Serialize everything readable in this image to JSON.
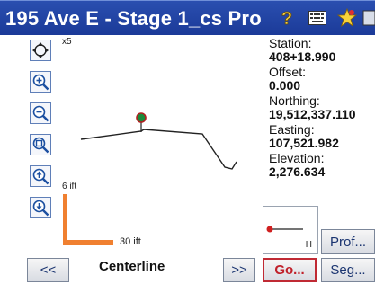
{
  "window": {
    "title": "195 Ave E - Stage 1_cs Pro"
  },
  "titlebar_icons": [
    "help-icon",
    "keyboard-icon",
    "star-icon"
  ],
  "toolbar": {
    "zoom_label": "x5",
    "tools": [
      "pan-tool-icon",
      "zoom-in-icon",
      "zoom-out-icon",
      "zoom-window-icon",
      "scroll-up-icon",
      "scroll-down-icon"
    ]
  },
  "graph": {
    "vertical_scale_label": "6 ift",
    "horizontal_scale_label": "30 ift",
    "scale_color": "#f08030",
    "target_color": "#1a8a3a"
  },
  "info": {
    "station_label": "Station:",
    "station_value": "408+18.990",
    "offset_label": "Offset:",
    "offset_value": "0.000",
    "northing_label": "Northing:",
    "northing_value": "19,512,337.110",
    "easting_label": "Easting:",
    "easting_value": "107,521.982",
    "elevation_label": "Elevation:",
    "elevation_value": "2,276.634"
  },
  "profile_icon": {
    "label": "H"
  },
  "buttons": {
    "prev": "<<",
    "next": ">>",
    "centerline": "Centerline",
    "go": "Go...",
    "prof": "Prof...",
    "seg": "Seg..."
  }
}
